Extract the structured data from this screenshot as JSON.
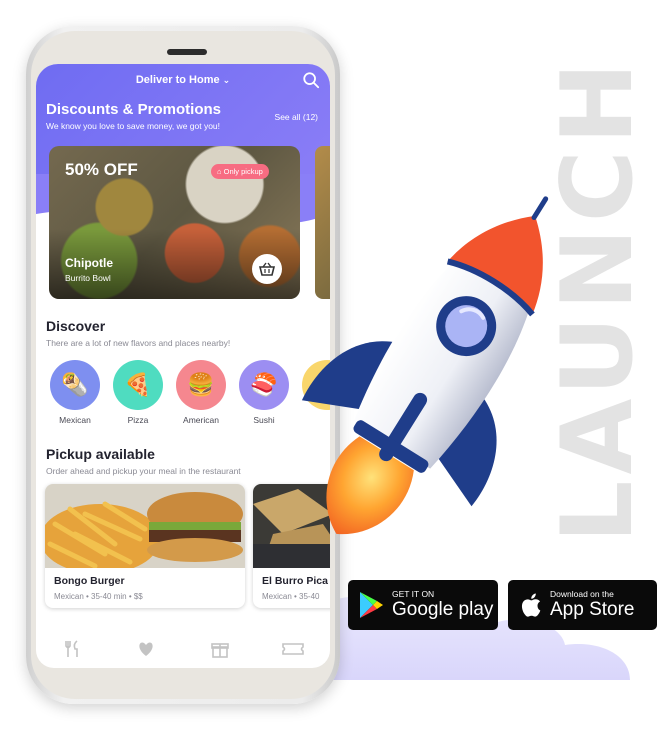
{
  "launch_text": "LAUNCH",
  "app": {
    "deliver_label": "Deliver to Home",
    "promotions": {
      "title": "Discounts & Promotions",
      "subtitle": "We know you love to save money, we got you!",
      "see_all": "See all (12)",
      "card": {
        "discount": "50% OFF",
        "badge": "Only pickup",
        "name": "Chipotle",
        "dish": "Burrito Bowl"
      }
    },
    "discover": {
      "title": "Discover",
      "subtitle": "There are a lot of new flavors and places nearby!",
      "categories": [
        {
          "label": "Mexican",
          "color": "#7e8ff0"
        },
        {
          "label": "Pizza",
          "color": "#4fdcc0"
        },
        {
          "label": "American",
          "color": "#f5878f"
        },
        {
          "label": "Sushi",
          "color": "#9c8ef2"
        }
      ]
    },
    "pickup": {
      "title": "Pickup available",
      "subtitle": "Order ahead and pickup your meal in the restaurant",
      "restaurants": [
        {
          "name": "Bongo Burger",
          "meta": "Mexican • 35-40 min • $$"
        },
        {
          "name": "El Burro Pica",
          "meta": "Mexican • 35-40"
        }
      ]
    },
    "tabs": [
      "fork-knife-icon",
      "heart-icon",
      "gift-icon",
      "ticket-icon"
    ]
  },
  "stores": {
    "google": {
      "line1": "GET IT ON",
      "line2": "Google play"
    },
    "apple": {
      "line1": "Download on the",
      "line2": "App Store"
    }
  },
  "colors": {
    "header": "#7673f3",
    "pickup_badge": "#f76c82",
    "rocket_nose": "#f2542d",
    "rocket_fin": "#1f3d8a"
  }
}
